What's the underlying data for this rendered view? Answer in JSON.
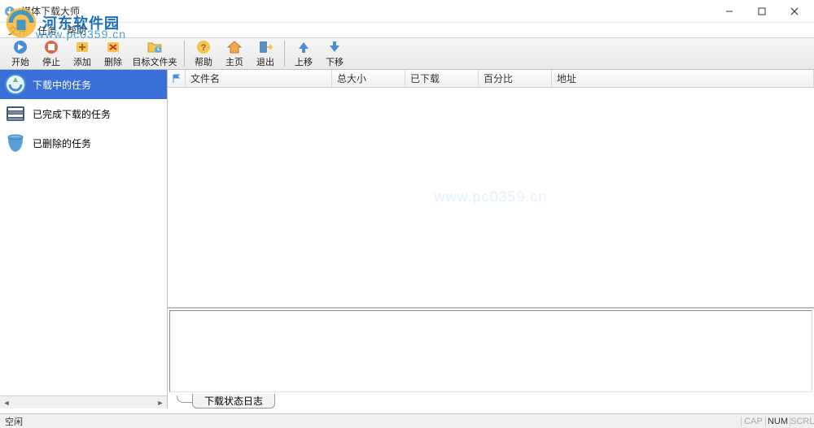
{
  "window": {
    "title": "媒体下载大师"
  },
  "menubar": {
    "file": "文件",
    "task": "任务",
    "help": "帮助"
  },
  "toolbar": {
    "start": "开始",
    "stop": "停止",
    "add": "添加",
    "delete": "删除",
    "target_folder": "目标文件夹",
    "help": "帮助",
    "home": "主页",
    "exit": "退出",
    "move_up": "上移",
    "move_down": "下移"
  },
  "sidebar": {
    "items": [
      {
        "label": "下载中的任务"
      },
      {
        "label": "已完成下载的任务"
      },
      {
        "label": "已删除的任务"
      }
    ]
  },
  "table": {
    "columns": {
      "filename": "文件名",
      "total_size": "总大小",
      "downloaded": "已下载",
      "percent": "百分比",
      "url": "地址"
    }
  },
  "log": {
    "tab_label": "下载状态日志"
  },
  "statusbar": {
    "text": "空闲",
    "cap": "CAP",
    "num": "NUM",
    "scrl": "SCRL"
  },
  "watermark": {
    "brand": "河东软件园",
    "url": "www.pc0359.cn",
    "body_mark": "www.pc0359.cn"
  }
}
